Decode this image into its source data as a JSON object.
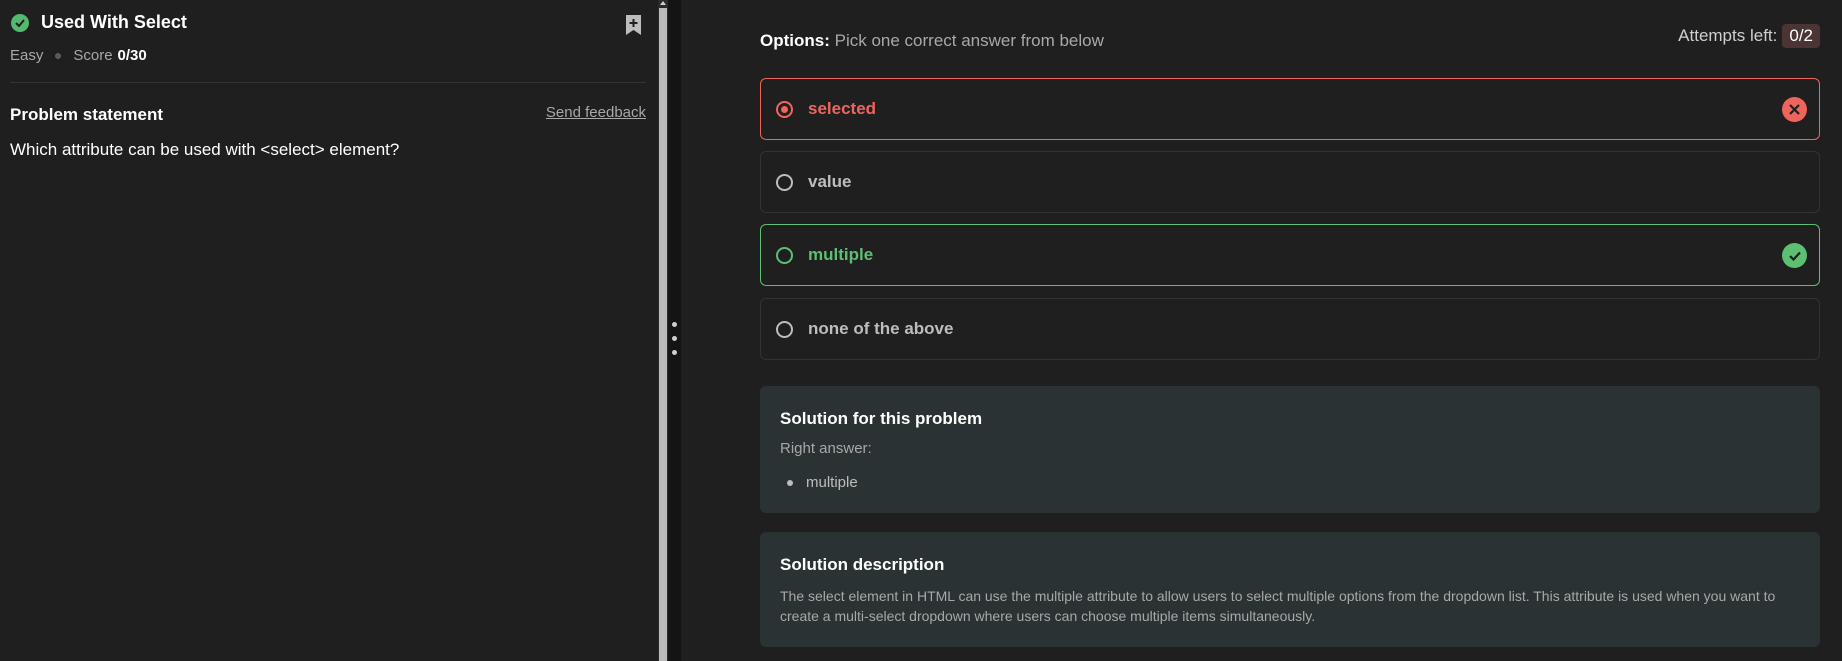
{
  "problem": {
    "title": "Used With Select",
    "difficulty": "Easy",
    "score_label": "Score",
    "score_value": "0/30",
    "statement_heading": "Problem statement",
    "feedback_link": "Send feedback",
    "question": "Which attribute can be used with <select> element?"
  },
  "options_panel": {
    "heading_bold": "Options:",
    "heading_hint": "Pick one correct answer from below",
    "attempts_label": "Attempts left:",
    "attempts_value": "0/2",
    "options": [
      {
        "label": "selected",
        "state": "wrong-selected"
      },
      {
        "label": "value",
        "state": "neutral"
      },
      {
        "label": "multiple",
        "state": "correct"
      },
      {
        "label": "none of the above",
        "state": "neutral"
      }
    ]
  },
  "solution": {
    "title": "Solution for this problem",
    "subtitle": "Right answer:",
    "answers": [
      "multiple"
    ]
  },
  "description": {
    "title": "Solution description",
    "text": "The select element in HTML can use the multiple attribute to allow users to select multiple options from the dropdown list. This attribute is used when you want to create a multi-select dropdown where users can choose multiple items simultaneously."
  },
  "colors": {
    "correct": "#5dbf72",
    "wrong": "#f0645e",
    "solution_bg": "#2a3233"
  },
  "icons": [
    "check-circle-icon",
    "bookmark-add-icon",
    "close-icon",
    "checkmark-icon",
    "drag-handle-icon"
  ]
}
